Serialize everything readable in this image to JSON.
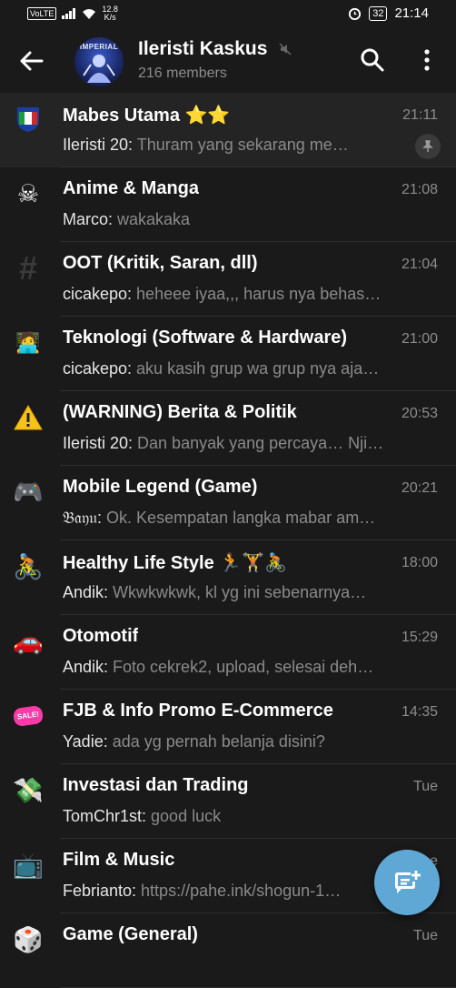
{
  "status_bar": {
    "volte": "VoLTE",
    "speed_value": "12.8",
    "speed_unit": "K/s",
    "battery": "32",
    "time": "21:14"
  },
  "header": {
    "avatar_text": "IMPERIAL",
    "title": "Ileristi Kaskus",
    "subtitle": "216 members",
    "icons": [
      "back-arrow-icon",
      "mute-icon",
      "search-icon",
      "more-vert-icon"
    ]
  },
  "topics": [
    {
      "icon": "🇮🇹",
      "title": "Mabes Utama ⭐⭐",
      "time": "21:11",
      "sender": "Ileristi 20:",
      "message": " Thuram yang sekarang me…",
      "pinned": true
    },
    {
      "icon": "☠",
      "title": "Anime & Manga",
      "time": "21:08",
      "sender": "Marco:",
      "message": " wakakaka"
    },
    {
      "icon": "#",
      "title": "OOT (Kritik, Saran, dll)",
      "time": "21:04",
      "sender": "cicakepo:",
      "message": " heheee iyaa,,, harus nya behas…"
    },
    {
      "icon": "🧑‍💻",
      "title": "Teknologi (Software & Hardware)",
      "time": "21:00",
      "sender": "cicakepo:",
      "message": " aku kasih grup wa grup nya aja…"
    },
    {
      "icon": "⚠️",
      "title": "(WARNING) Berita & Politik",
      "time": "20:53",
      "sender": "Ileristi 20:",
      "message": " Dan banyak yang percaya… Nji…"
    },
    {
      "icon": "🎮",
      "title": "Mobile Legend (Game)",
      "time": "20:21",
      "sender": "𝔅𝔞𝔶𝔲:",
      "message": " Ok. Kesempatan langka mabar am…"
    },
    {
      "icon": "🚴",
      "title": "Healthy Life Style 🏃🏋🚴",
      "time": "18:00",
      "sender": "Andik:",
      "message": " Wkwkwkwk, kl yg ini sebenarnya…"
    },
    {
      "icon": "🚗",
      "title": "Otomotif",
      "time": "15:29",
      "sender": "Andik:",
      "message": " Foto cekrek2, upload, selesai deh…"
    },
    {
      "icon": "SALE!",
      "title": "FJB & Info Promo E-Commerce",
      "time": "14:35",
      "sender": "Yadie:",
      "message": " ada yg pernah belanja disini?"
    },
    {
      "icon": "💸",
      "title": "Investasi dan Trading",
      "time": "Tue",
      "sender": "TomChr1st:",
      "message": " good luck"
    },
    {
      "icon": "📺",
      "title": "Film & Music",
      "time": "Tue",
      "sender": "Febrianto:",
      "message": " https://pahe.ink/shogun-1…"
    },
    {
      "icon": "🎲",
      "title": "Game (General)",
      "time": "Tue",
      "sender": "",
      "message": ""
    }
  ],
  "fab": {
    "icon": "new-message-icon"
  },
  "colors": {
    "background": "#1a1a1a",
    "pinned_row": "#242424",
    "accent": "#5fa8d6",
    "secondary_text": "#8c8c8c"
  }
}
